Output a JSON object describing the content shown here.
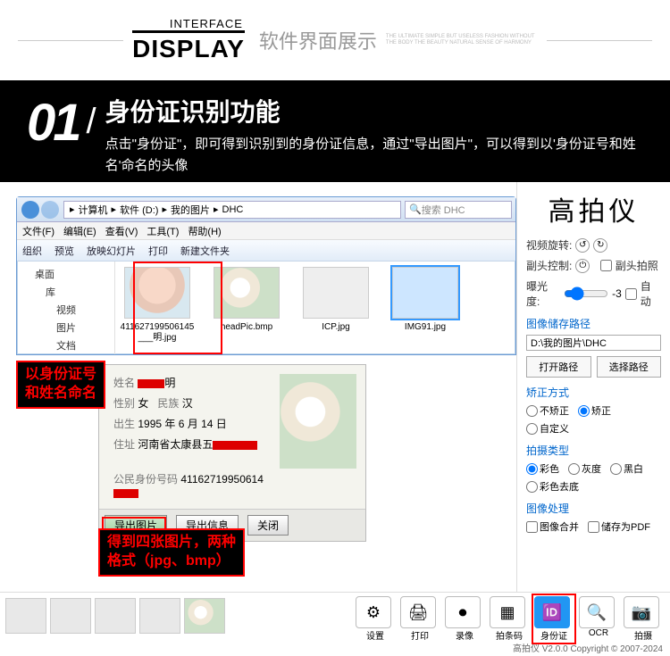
{
  "banner": {
    "sub": "INTERFACE",
    "main": "DISPLAY",
    "cn": "软件界面展示",
    "tiny": "THE ULTIMATE SIMPLE BUT USELESS FASHION WITHOUT THE BODY THE BEAUTY NATURAL SENSE OF HARMONY"
  },
  "section": {
    "num": "01",
    "title": "身份证识别功能",
    "desc": "点击\"身份证\"，即可得到识别到的身份证信息，通过\"导出图片\"，可以得到以'身份证号和姓名'命名的头像"
  },
  "explorer": {
    "path": [
      "计算机",
      "软件 (D:)",
      "我的图片",
      "DHC"
    ],
    "search_placeholder": "搜索 DHC",
    "menus": [
      "文件(F)",
      "编辑(E)",
      "查看(V)",
      "工具(T)",
      "帮助(H)"
    ],
    "toolbar": [
      "组织",
      "预览",
      "放映幻灯片",
      "打印",
      "新建文件夹"
    ],
    "tree": [
      "桌面",
      "库",
      "视频",
      "图片",
      "文档"
    ],
    "files": [
      {
        "name": "411627199506145___明.jpg",
        "kind": "face"
      },
      {
        "name": "headPic.bmp",
        "kind": "lily"
      },
      {
        "name": "ICP.jpg",
        "kind": "card"
      },
      {
        "name": "IMG91.jpg",
        "kind": "card"
      }
    ]
  },
  "callouts": {
    "naming": "以身份证号\n和姓名命名",
    "export": "得到四张图片，两种\n格式（jpg、bmp）"
  },
  "idpanel": {
    "name_label": "姓名",
    "gender_label": "性别",
    "gender": "女",
    "nation_label": "民族",
    "nation": "汉",
    "birth_label": "出生",
    "birth": "1995 年 6 月 14 日",
    "addr_label": "住址",
    "addr": "河南省太康县五",
    "idno_label": "公民身份号码",
    "idno": "41162719950614",
    "btn_export_img": "导出图片",
    "btn_export_info": "导出信息",
    "btn_close": "关闭"
  },
  "side": {
    "title": "高拍仪",
    "rotation_label": "视频旋转:",
    "sub_label": "副头控制:",
    "sub_check": "副头拍照",
    "exposure_label": "曝光度:",
    "exposure_val": "-3",
    "auto_label": "自动",
    "path_title": "图像储存路径",
    "path_value": "D:\\我的图片\\DHC",
    "btn_open": "打开路径",
    "btn_choose": "选择路径",
    "correct_title": "矫正方式",
    "correct_opts": [
      "不矫正",
      "矫正",
      "自定义"
    ],
    "correct_sel": 1,
    "shoot_title": "拍摄类型",
    "shoot_opts": [
      "彩色",
      "灰度",
      "黑白",
      "彩色去底"
    ],
    "shoot_sel": 0,
    "proc_title": "图像处理",
    "proc_merge": "图像合并",
    "proc_pdf": "储存为PDF"
  },
  "bottom": {
    "tools": [
      {
        "id": "settings",
        "label": "设置",
        "glyph": "⚙"
      },
      {
        "id": "print",
        "label": "打印",
        "glyph": "🖨"
      },
      {
        "id": "record",
        "label": "录像",
        "glyph": "⏺"
      },
      {
        "id": "barcode",
        "label": "拍条码",
        "glyph": "▦"
      },
      {
        "id": "idcard",
        "label": "身份证",
        "glyph": "🆔"
      },
      {
        "id": "ocr",
        "label": "OCR",
        "glyph": "🔍"
      },
      {
        "id": "capture",
        "label": "拍摄",
        "glyph": "📷"
      }
    ],
    "active": "idcard",
    "copyright": "高拍仪 V2.0.0 Copyright © 2007-2024"
  }
}
